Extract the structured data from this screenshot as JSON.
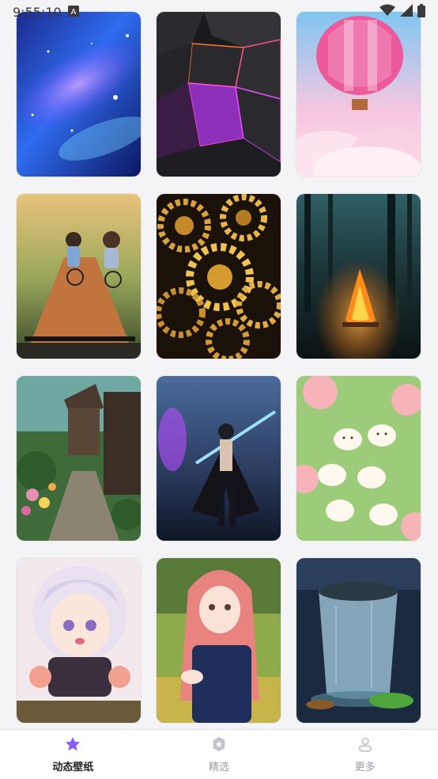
{
  "status_bar": {
    "time": "9:55:10",
    "notification_icon": "a-notification-icon",
    "wifi_icon": "wifi-icon",
    "signal_icon": "cell-signal-icon",
    "battery_icon": "battery-icon"
  },
  "wallpapers": [
    {
      "theme": "galaxy"
    },
    {
      "theme": "neon-cracked-stone"
    },
    {
      "theme": "pink-hot-air-balloon"
    },
    {
      "theme": "anime-kids-cycling"
    },
    {
      "theme": "golden-gears"
    },
    {
      "theme": "forest-campfire"
    },
    {
      "theme": "garden-village-path"
    },
    {
      "theme": "dark-swordsman"
    },
    {
      "theme": "cute-chicks-on-green"
    },
    {
      "theme": "anime-girl-white-hair"
    },
    {
      "theme": "anime-girl-pink-hair"
    },
    {
      "theme": "glass-of-water"
    }
  ],
  "tab_bar": {
    "items": [
      {
        "label": "动态壁纸",
        "icon": "star-icon",
        "active": true
      },
      {
        "label": "精选",
        "icon": "badge-icon",
        "active": false
      },
      {
        "label": "更多",
        "icon": "person-icon",
        "active": false
      }
    ],
    "accent_color": "#8b5cf6",
    "inactive_color": "#c4c4cc"
  }
}
